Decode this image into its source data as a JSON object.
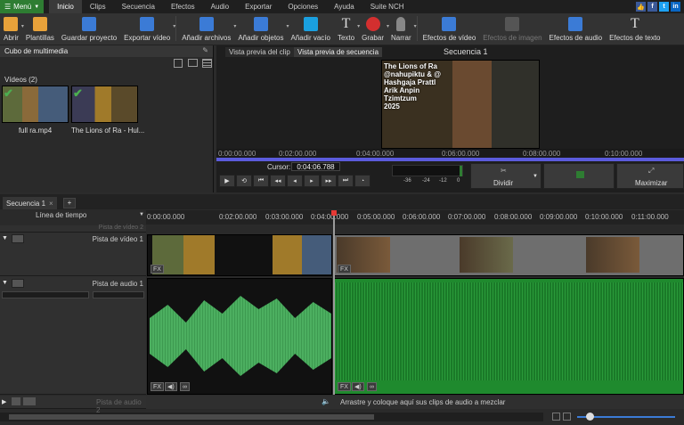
{
  "menu": {
    "menu_label": "Menú",
    "tabs": [
      "Inicio",
      "Clips",
      "Secuencia",
      "Efectos",
      "Audio",
      "Exportar",
      "Opciones",
      "Ayuda",
      "Suite NCH"
    ]
  },
  "toolbar": {
    "buttons": [
      {
        "label": "Abrir",
        "color": "#e8a23a"
      },
      {
        "label": "Plantillas",
        "color": "#e8a23a"
      },
      {
        "label": "Guardar proyecto",
        "color": "#3b7bd6"
      },
      {
        "label": "Exportar vídeo",
        "color": "#3b7bd6"
      },
      {
        "label": "Añadir archivos",
        "color": "#3b7bd6"
      },
      {
        "label": "Añadir objetos",
        "color": "#3b7bd6"
      },
      {
        "label": "Añadir vacío",
        "color": "#1aa0e0"
      },
      {
        "label": "Texto",
        "color": "#cccccc"
      },
      {
        "label": "Grabar",
        "color": "#d32f2f"
      },
      {
        "label": "Narrar",
        "color": "#888888"
      },
      {
        "label": "Efectos de vídeo",
        "color": "#3b7bd6"
      },
      {
        "label": "Efectos de imagen",
        "color": "#666666"
      },
      {
        "label": "Efectos de audio",
        "color": "#3b7bd6"
      },
      {
        "label": "Efectos de texto",
        "color": "#cccccc"
      }
    ]
  },
  "media": {
    "header": "Cubo de multimedia",
    "section": "Vídeos (2)",
    "items": [
      {
        "name": "full ra.mp4"
      },
      {
        "name": "The Lions of Ra - Hul..."
      }
    ]
  },
  "preview": {
    "tab_clip": "Vista previa del clip",
    "tab_sequence": "Vista previa de secuencia",
    "title": "Secuencia 1",
    "overlay_lines": [
      "The Lions of Ra",
      "@nahupiktu & @",
      "Hashgaja Prattl",
      "Arik Anpin",
      "Tzimtzum",
      "2025"
    ],
    "ruler_ticks": [
      "0:00:00.000",
      "0:02:00.000",
      "0:04:00.000",
      "0:06:00.000",
      "0:08:00.000",
      "0:10:00.000"
    ],
    "cursor_label": "Cursor:",
    "cursor_value": "0:04:06.788",
    "meter_ticks": [
      "-36",
      "-24",
      "-12",
      "0"
    ],
    "split_label": "Dividir",
    "maximize_label": "Maximizar"
  },
  "timeline": {
    "seq_tab": "Secuencia 1",
    "add_tab": "+",
    "view_label": "Línea de tiempo",
    "ticks": [
      "0:00:00.000",
      "0:02:00.000",
      "0:03:00.000",
      "0:04:00.000",
      "0:05:00.000",
      "0:06:00.000",
      "0:07:00.000",
      "0:08:00.000",
      "0:09:00.000",
      "0:10:00.000",
      "0:11:00.000"
    ],
    "tracks": {
      "video2": "Pista de vídeo 2",
      "video1": "Pista de vídeo 1",
      "audio1": "Pista de audio 1",
      "audio2": "Pista de audio 2"
    },
    "drop_hint": "Arrastre y coloque aquí sus clips de audio a mezclar"
  },
  "colors": {
    "accent": "#2e7d32",
    "waveform_light": "#4caf60",
    "waveform_dark": "#1f8a2e",
    "playhead": "#e53935",
    "progress": "#5b5bdc"
  }
}
